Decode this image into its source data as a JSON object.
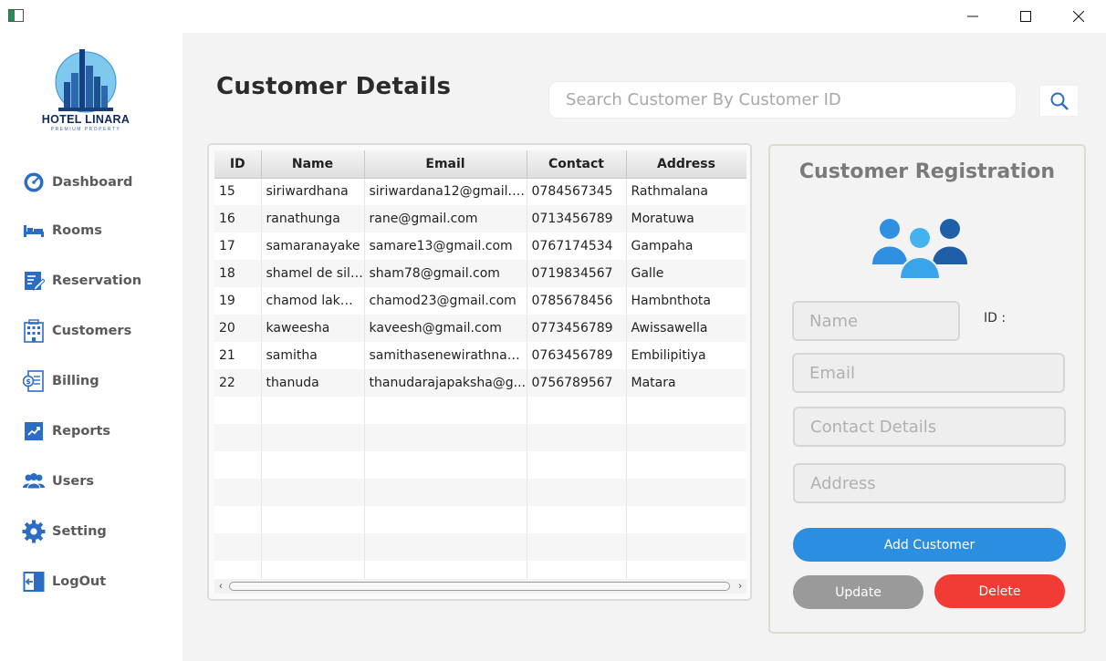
{
  "window": {
    "controls": {
      "minimize_icon": "minimize-icon",
      "maximize_icon": "maximize-icon",
      "close_icon": "close-icon"
    }
  },
  "sidebar": {
    "logo": {
      "name": "HOTEL LINARA",
      "tagline": "PREMIUM PROPERTY"
    },
    "items": [
      {
        "label": "Dashboard",
        "icon": "speedometer-icon"
      },
      {
        "label": "Rooms",
        "icon": "bed-icon"
      },
      {
        "label": "Reservation",
        "icon": "edit-document-icon"
      },
      {
        "label": "Customers",
        "icon": "building-icon"
      },
      {
        "label": "Billing",
        "icon": "invoice-icon"
      },
      {
        "label": "Reports",
        "icon": "chart-up-icon"
      },
      {
        "label": "Users",
        "icon": "users-icon"
      },
      {
        "label": "Setting",
        "icon": "gear-icon"
      },
      {
        "label": "LogOut",
        "icon": "logout-icon"
      }
    ]
  },
  "main": {
    "title": "Customer Details",
    "search": {
      "placeholder": "Search Customer By Customer ID",
      "value": ""
    },
    "table": {
      "columns": [
        "ID",
        "Name",
        "Email",
        "Contact",
        "Address"
      ],
      "rows": [
        {
          "id": "15",
          "name": "siriwardhana",
          "email": "siriwardana12@gmail.c...",
          "contact": "0784567345",
          "address": "Rathmalana"
        },
        {
          "id": "16",
          "name": "ranathunga",
          "email": "rane@gmail.com",
          "contact": "0713456789",
          "address": "Moratuwa"
        },
        {
          "id": "17",
          "name": "samaranayake",
          "email": "samare13@gmail.com",
          "contact": "0767174534",
          "address": "Gampaha"
        },
        {
          "id": "18",
          "name": "shamel de silva",
          "email": "sham78@gmail.com",
          "contact": "0719834567",
          "address": "Galle"
        },
        {
          "id": "19",
          "name": "chamod lakmal",
          "email": "chamod23@gmail.com",
          "contact": "0785678456",
          "address": "Hambnthota"
        },
        {
          "id": "20",
          "name": "kaweesha",
          "email": "kaveesh@gmail.com",
          "contact": "0773456789",
          "address": "Awissawella"
        },
        {
          "id": "21",
          "name": "samitha",
          "email": "samithasenewirathna@...",
          "contact": "0763456789",
          "address": "Embilipitiya"
        },
        {
          "id": "22",
          "name": "thanuda",
          "email": "thanudarajapaksha@g...",
          "contact": "0756789567",
          "address": "Matara"
        }
      ],
      "empty_rows": 7
    }
  },
  "form": {
    "title": "Customer Registration",
    "id_label": "ID :",
    "name_placeholder": "Name",
    "email_placeholder": "Email",
    "contact_placeholder": "Contact Details",
    "address_placeholder": "Address",
    "add_label": "Add Customer",
    "update_label": "Update",
    "delete_label": "Delete"
  },
  "colors": {
    "primary": "#2b8ee0",
    "danger": "#f03c34",
    "neutral": "#9a9a9a",
    "sidebar_icon": "#2b6cc4"
  }
}
